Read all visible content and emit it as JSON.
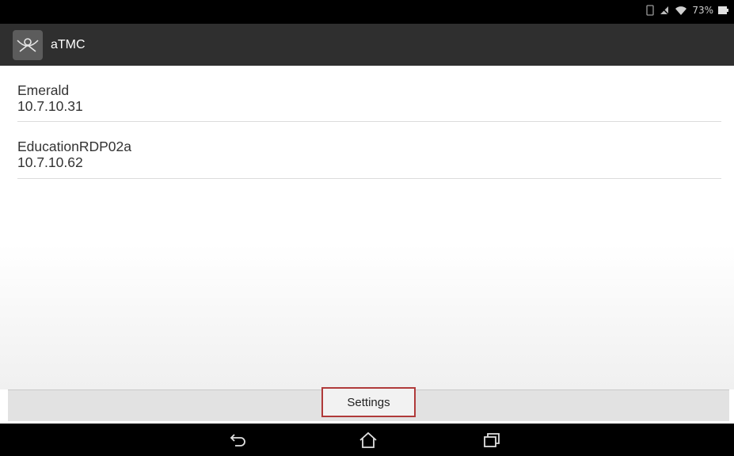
{
  "status_bar": {
    "battery_text": "73%"
  },
  "action_bar": {
    "app_title": "aTMC",
    "icon": "atmc-logo-icon"
  },
  "connections": [
    {
      "name": "Emerald",
      "ip": "10.7.10.31"
    },
    {
      "name": "EducationRDP02a",
      "ip": "10.7.10.62"
    }
  ],
  "bottom": {
    "settings_label": "Settings"
  },
  "nav": {
    "back_icon": "back-icon",
    "home_icon": "home-icon",
    "recents_icon": "recents-icon"
  },
  "colors": {
    "action_bar": "#2f2f2f",
    "highlight_border": "#b03a3a"
  }
}
